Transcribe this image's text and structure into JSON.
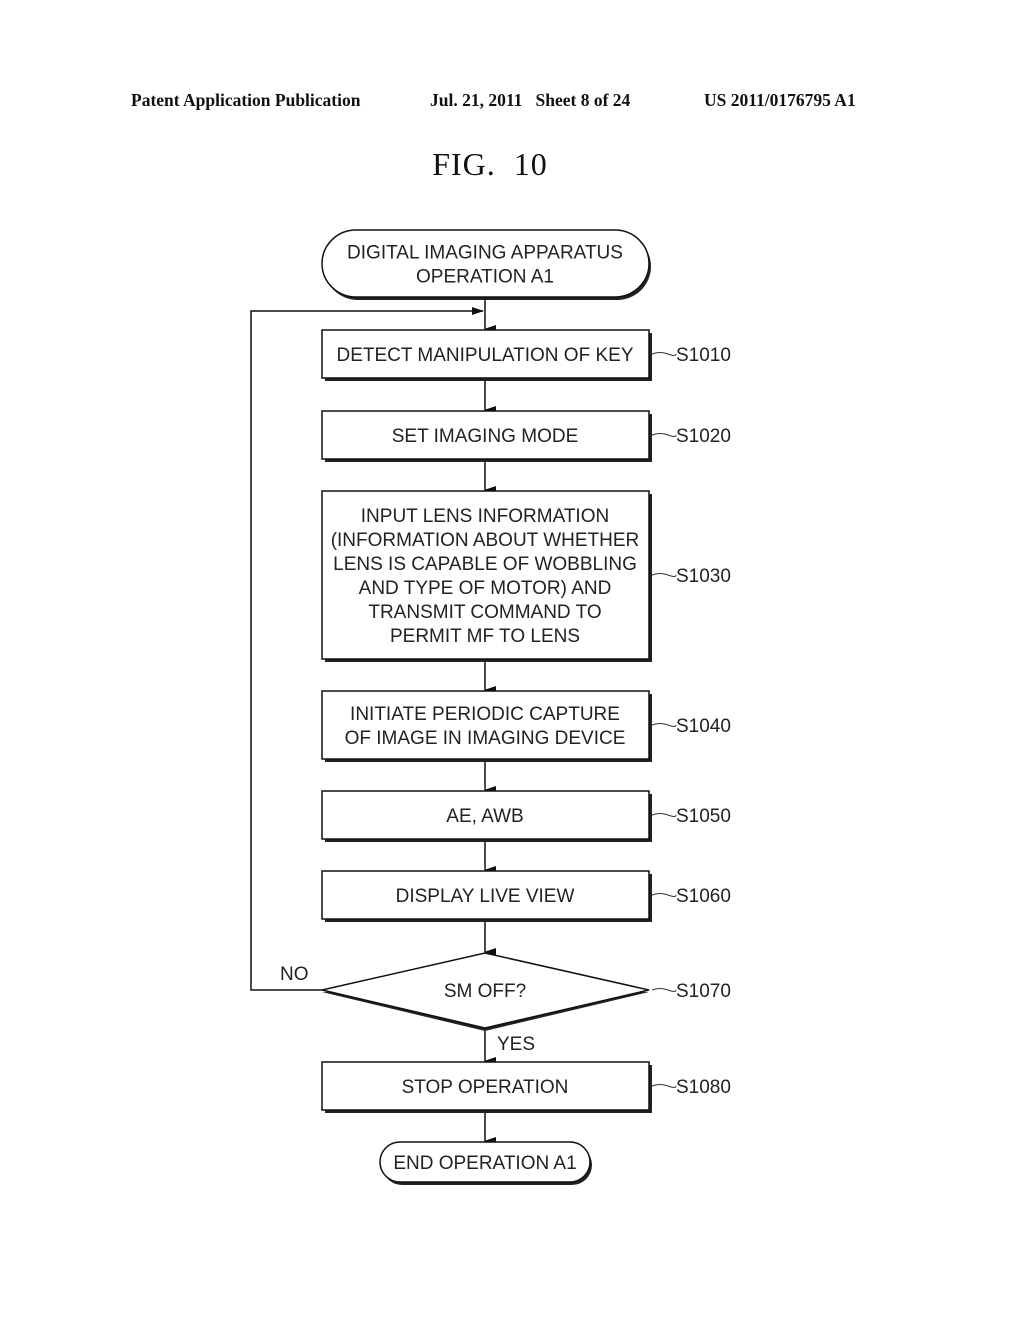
{
  "header": {
    "publication": "Patent Application Publication",
    "date_sheet": "Jul. 21, 2011   Sheet 8 of 24",
    "patent_number": "US 2011/0176795 A1"
  },
  "figure": {
    "title": "FIG.  10"
  },
  "flowchart": {
    "start": {
      "lines": [
        "DIGITAL IMAGING APPARATUS",
        "OPERATION A1"
      ]
    },
    "steps": [
      {
        "id": "S1010",
        "lines": [
          "DETECT MANIPULATION OF KEY"
        ]
      },
      {
        "id": "S1020",
        "lines": [
          "SET IMAGING MODE"
        ]
      },
      {
        "id": "S1030",
        "lines": [
          "INPUT LENS INFORMATION",
          "(INFORMATION ABOUT WHETHER",
          "LENS IS CAPABLE OF WOBBLING",
          "AND TYPE OF MOTOR) AND",
          "TRANSMIT COMMAND TO",
          "PERMIT MF TO LENS"
        ]
      },
      {
        "id": "S1040",
        "lines": [
          "INITIATE PERIODIC CAPTURE",
          "OF IMAGE IN IMAGING DEVICE"
        ]
      },
      {
        "id": "S1050",
        "lines": [
          "AE, AWB"
        ]
      },
      {
        "id": "S1060",
        "lines": [
          "DISPLAY LIVE VIEW"
        ]
      }
    ],
    "decision": {
      "id": "S1070",
      "text": "SM OFF?",
      "no_label": "NO",
      "yes_label": "YES"
    },
    "final_step": {
      "id": "S1080",
      "lines": [
        "STOP OPERATION"
      ]
    },
    "end": {
      "lines": [
        "END OPERATION A1"
      ]
    }
  }
}
